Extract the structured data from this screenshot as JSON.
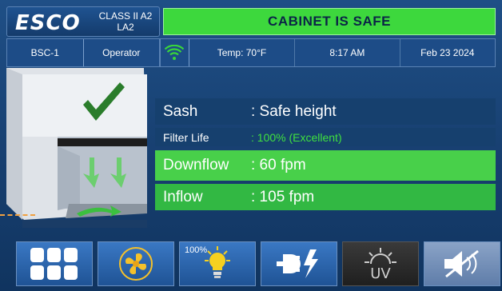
{
  "brand": {
    "logo": "ESCO",
    "class_line1": "CLASS II A2",
    "class_line2": "LA2"
  },
  "status": {
    "message": "CABINET IS SAFE",
    "color": "#3dd83d"
  },
  "info": {
    "unit": "BSC-1",
    "user": "Operator"
  },
  "status_bar": {
    "temp": "Temp: 70°F",
    "time": "8:17 AM",
    "date": "Feb 23 2024"
  },
  "readouts": {
    "sash": {
      "label": "Sash",
      "value": ": Safe height"
    },
    "filter": {
      "label": "Filter Life",
      "value": ": 100% (Excellent)"
    },
    "downflow": {
      "label": "Downflow",
      "value": ": 60 fpm"
    },
    "inflow": {
      "label": "Inflow",
      "value": ": 105 fpm"
    }
  },
  "toolbar": {
    "lamp_percent": "100%",
    "icons": [
      "menu-grid-icon",
      "fan-icon",
      "light-bulb-icon",
      "power-outlet-icon",
      "uv-lamp-icon",
      "mute-alarm-icon"
    ]
  }
}
